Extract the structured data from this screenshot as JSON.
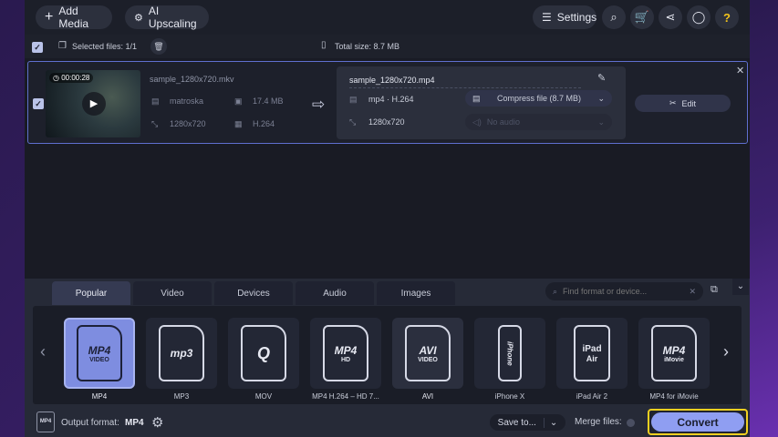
{
  "topbar": {
    "add_media": "Add Media",
    "ai_upscaling": "AI Upscaling",
    "settings": "Settings",
    "help": "?"
  },
  "selection": {
    "selected_files": "Selected files: 1/1",
    "total_size": "Total size: 8.7 MB"
  },
  "file": {
    "duration": "00:00:28",
    "source_name": "sample_1280x720.mkv",
    "container": "matroska",
    "size": "17.4 MB",
    "resolution": "1280x720",
    "codec": "H.264",
    "output_name": "sample_1280x720.mp4",
    "output_format": "mp4 · H.264",
    "compress": "Compress file (8.7 MB)",
    "output_resolution": "1280x720",
    "audio": "No audio",
    "edit": "Edit"
  },
  "tabs": [
    "Popular",
    "Video",
    "Devices",
    "Audio",
    "Images"
  ],
  "search": {
    "placeholder": "Find format or device..."
  },
  "formats": [
    {
      "label": "MP4",
      "icon": "MP4",
      "sub": "VIDEO"
    },
    {
      "label": "MP3",
      "icon": "mp3",
      "sub": ""
    },
    {
      "label": "MOV",
      "icon": "Q",
      "sub": ""
    },
    {
      "label": "MP4 H.264 – HD 7...",
      "icon": "MP4",
      "sub": "HD"
    },
    {
      "label": "AVI",
      "icon": "AVI",
      "sub": "VIDEO"
    },
    {
      "label": "iPhone X",
      "icon": "iPhone",
      "sub": ""
    },
    {
      "label": "iPad Air 2",
      "icon": "iPad",
      "sub": "Air"
    },
    {
      "label": "MP4 for iMovie",
      "icon": "MP4",
      "sub": "iMovie"
    }
  ],
  "bottom": {
    "output_format_label": "Output format:",
    "output_format_value": "MP4",
    "save_to": "Save to...",
    "merge_files": "Merge files:",
    "convert": "Convert"
  },
  "colors": {
    "accent": "#8f9ef2",
    "highlight": "#f0d020",
    "selected_card": "#7e8de0"
  }
}
